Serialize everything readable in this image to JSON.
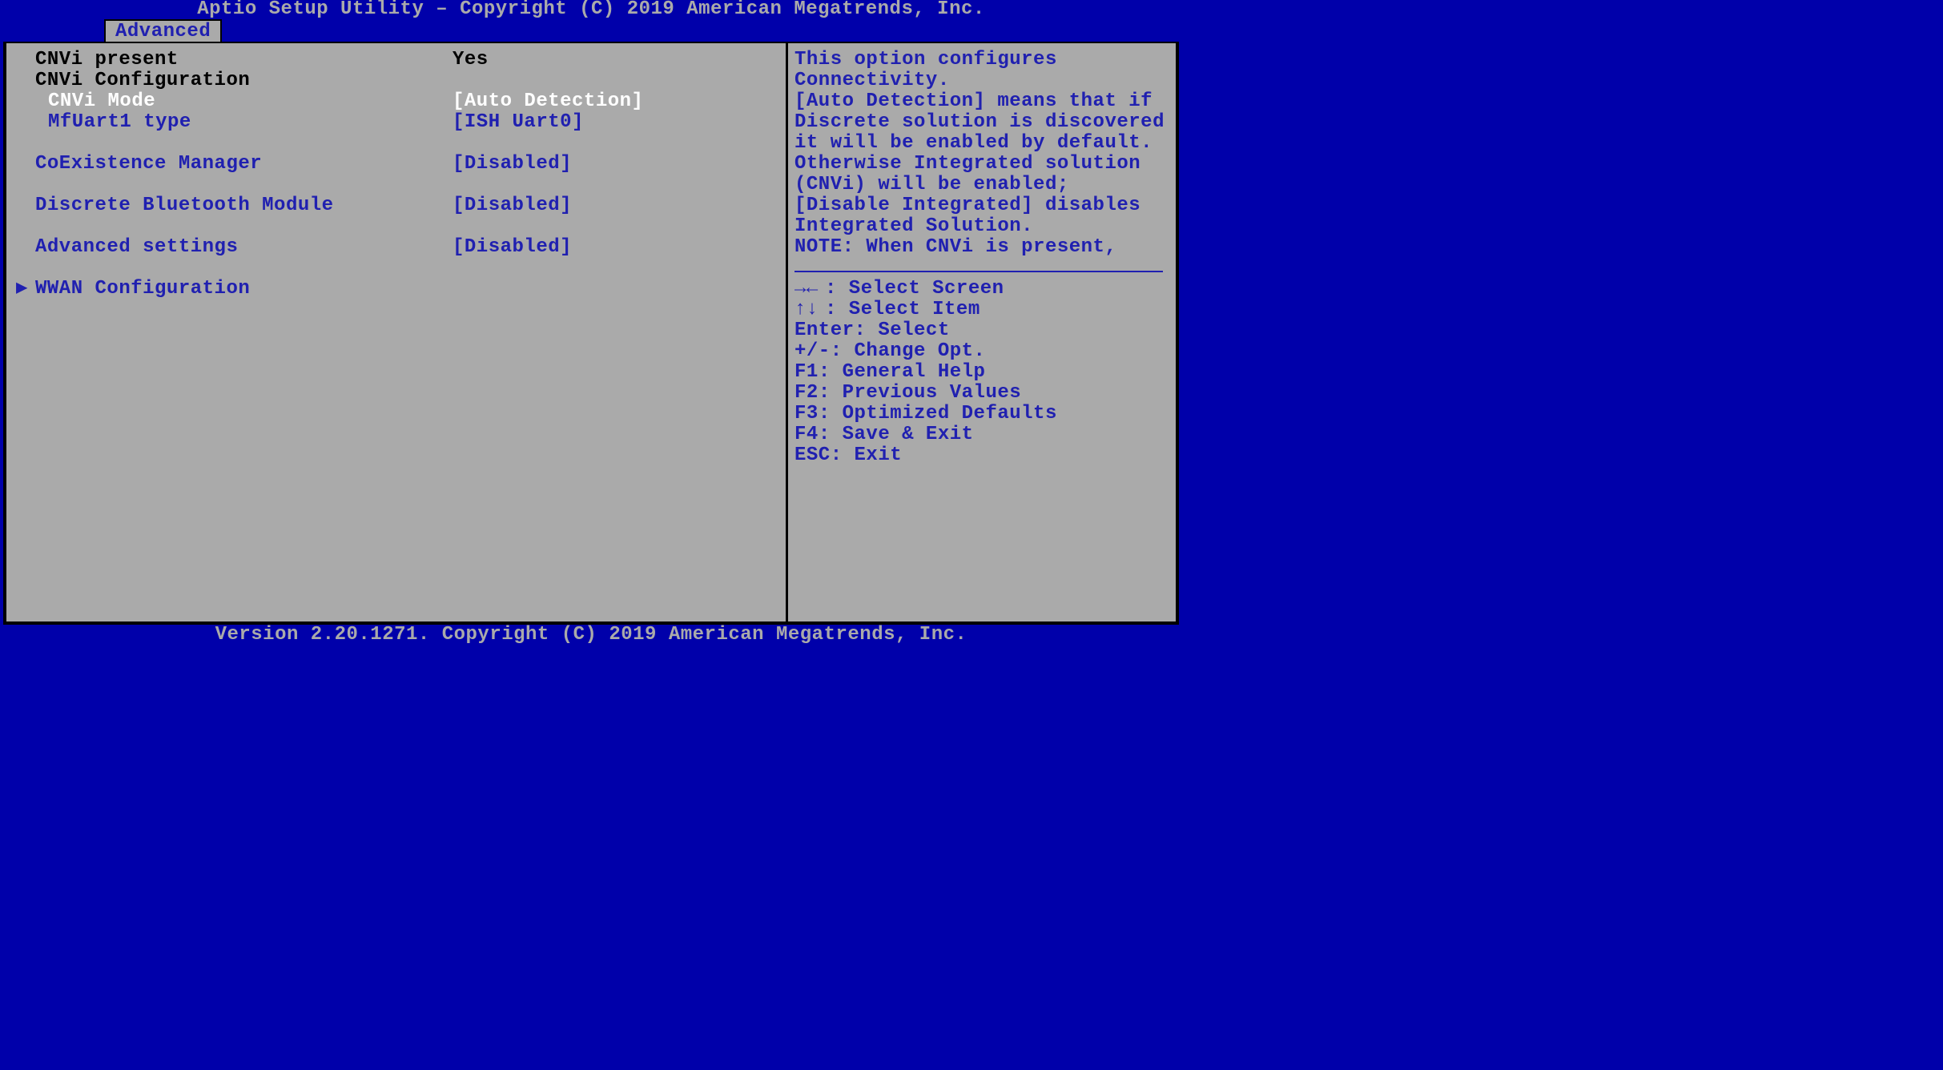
{
  "header": {
    "title": "Aptio Setup Utility – Copyright (C) 2019 American Megatrends, Inc."
  },
  "tab": {
    "label": "Advanced"
  },
  "settings": [
    {
      "label": "CNVi present",
      "value": "Yes",
      "type": "info",
      "indent": false
    },
    {
      "label": "CNVi Configuration",
      "value": "",
      "type": "info",
      "indent": false
    },
    {
      "label": "CNVi Mode",
      "value": "[Auto Detection]",
      "type": "option",
      "indent": true,
      "selected": true
    },
    {
      "label": "MfUart1 type",
      "value": "[ISH Uart0]",
      "type": "option",
      "indent": true
    },
    {
      "label": "",
      "value": "",
      "type": "spacer"
    },
    {
      "label": "CoExistence Manager",
      "value": "[Disabled]",
      "type": "option",
      "indent": false
    },
    {
      "label": "",
      "value": "",
      "type": "spacer"
    },
    {
      "label": "Discrete Bluetooth Module",
      "value": "[Disabled]",
      "type": "option",
      "indent": false
    },
    {
      "label": "",
      "value": "",
      "type": "spacer"
    },
    {
      "label": "Advanced settings",
      "value": "[Disabled]",
      "type": "option",
      "indent": false
    },
    {
      "label": "",
      "value": "",
      "type": "spacer"
    },
    {
      "label": "WWAN Configuration",
      "value": "",
      "type": "submenu",
      "indent": false
    }
  ],
  "help": {
    "text": "This option configures Connectivity.\n[Auto Detection] means that if Discrete solution is discovered it will be enabled by default. Otherwise Integrated solution (CNVi) will be enabled;\n[Disable Integrated] disables Integrated Solution.\nNOTE: When CNVi is present,"
  },
  "keys": [
    {
      "glyph": "→←",
      "label": ": Select Screen"
    },
    {
      "glyph": "↑↓",
      "label": ": Select Item"
    },
    {
      "glyph": "Enter",
      "label": ": Select"
    },
    {
      "glyph": "+/-",
      "label": ": Change Opt."
    },
    {
      "glyph": "F1",
      "label": ": General Help"
    },
    {
      "glyph": "F2",
      "label": ": Previous Values"
    },
    {
      "glyph": "F3",
      "label": ": Optimized Defaults"
    },
    {
      "glyph": "F4",
      "label": ": Save & Exit"
    },
    {
      "glyph": "ESC",
      "label": ": Exit"
    }
  ],
  "footer": {
    "text": "Version 2.20.1271. Copyright (C) 2019 American Megatrends, Inc."
  }
}
